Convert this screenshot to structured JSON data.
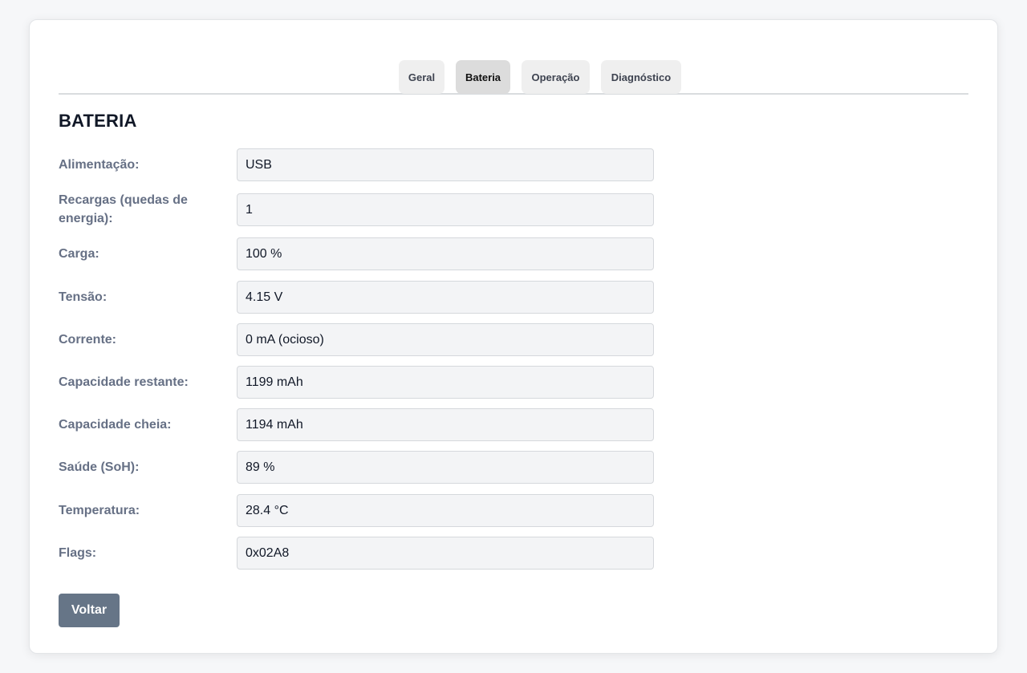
{
  "tabs": [
    {
      "label": "Geral",
      "active": false
    },
    {
      "label": "Bateria",
      "active": true
    },
    {
      "label": "Operação",
      "active": false
    },
    {
      "label": "Diagnóstico",
      "active": false
    }
  ],
  "section": {
    "title": "BATERIA"
  },
  "fields": [
    {
      "label": "Alimentação:",
      "value": "USB"
    },
    {
      "label": "Recargas (quedas de energia):",
      "value": "1"
    },
    {
      "label": "Carga:",
      "value": "100 %"
    },
    {
      "label": "Tensão:",
      "value": "4.15 V"
    },
    {
      "label": "Corrente:",
      "value": "0 mA (ocioso)"
    },
    {
      "label": "Capacidade restante:",
      "value": "1199 mAh"
    },
    {
      "label": "Capacidade cheia:",
      "value": "1194 mAh"
    },
    {
      "label": "Saúde (SoH):",
      "value": "89 %"
    },
    {
      "label": "Temperatura:",
      "value": "28.4 °C"
    },
    {
      "label": "Flags:",
      "value": "0x02A8"
    }
  ],
  "actions": {
    "back_label": "Voltar"
  },
  "colors": {
    "page_bg": "#f6f7f9",
    "button_bg": "#667587",
    "label_color": "#667085",
    "field_bg": "#f3f4f6"
  }
}
